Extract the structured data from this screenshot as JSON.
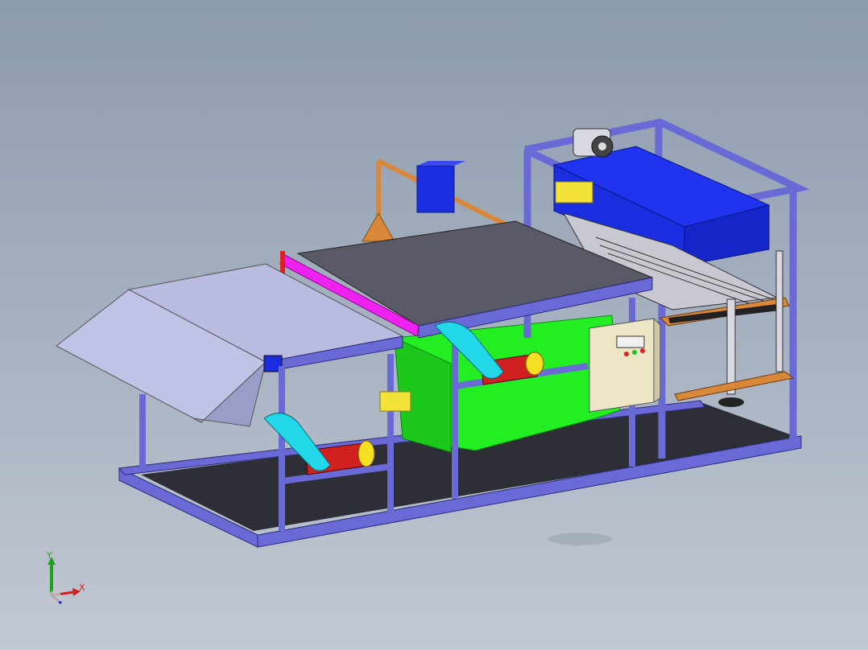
{
  "triad": {
    "x_label": "X",
    "y_label": "Y"
  },
  "colors": {
    "frame": "#6a6ad6",
    "frame_dark": "#3a3a9a",
    "conveyor_plate": "#b9bce0",
    "belt": "#5a5a66",
    "tank": "#22ee22",
    "motor_red": "#d02020",
    "motor_yellow": "#f4e020",
    "cyan_guard": "#22d8e8",
    "bracket_orange": "#d88838",
    "heater_blue": "#1a2ee0",
    "control_box": "#ece6c6",
    "floor_shadow": "#2e2e36"
  }
}
